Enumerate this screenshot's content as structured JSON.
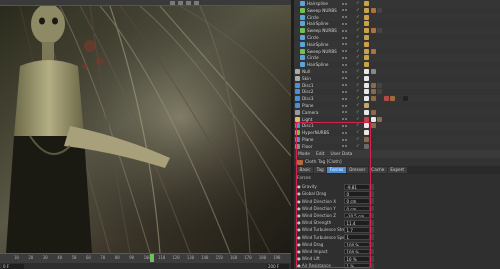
{
  "colors": {
    "accent": "#4a90d9",
    "highlight": "#d6204e",
    "check": "#7ec36f",
    "timeline_cursor": "#6fbf5a"
  },
  "timeline": {
    "ticks": [
      "10",
      "20",
      "30",
      "40",
      "50",
      "60",
      "70",
      "80",
      "90",
      "100",
      "110",
      "120",
      "130",
      "140",
      "150",
      "160",
      "170",
      "180",
      "190"
    ],
    "start_field": "0 F",
    "end_field": "200 F"
  },
  "object_manager": {
    "rows": [
      {
        "name": "Hairspline",
        "icon": "spline-icon"
      },
      {
        "name": "Sweep NURBS",
        "icon": "sweep-icon"
      },
      {
        "name": "Circle",
        "icon": "circle-icon"
      },
      {
        "name": "HairSpline",
        "icon": "spline-icon"
      },
      {
        "name": "Sweep NURBS",
        "icon": "sweep-icon"
      },
      {
        "name": "Circle",
        "icon": "circle-icon"
      },
      {
        "name": "HairSpline",
        "icon": "spline-icon"
      },
      {
        "name": "Sweep NURBS",
        "icon": "sweep-icon"
      },
      {
        "name": "Circle",
        "icon": "circle-icon"
      },
      {
        "name": "HairSpline",
        "icon": "spline-icon"
      },
      {
        "name": "Null",
        "icon": "null-icon"
      },
      {
        "name": "Skin",
        "icon": "null-icon"
      },
      {
        "name": "Disc1",
        "icon": "disc-icon"
      },
      {
        "name": "Disc2",
        "icon": "disc-icon"
      },
      {
        "name": "Disc3",
        "icon": "disc-icon"
      },
      {
        "name": "Plane",
        "icon": "plane-icon"
      },
      {
        "name": "Camera",
        "icon": "camera-icon"
      },
      {
        "name": "Light",
        "icon": "light-icon"
      },
      {
        "name": "Disc1",
        "icon": "disc-icon"
      },
      {
        "name": "HyperNURBS",
        "icon": "hypernurbs-icon"
      },
      {
        "name": "Plane",
        "icon": "plane-icon"
      },
      {
        "name": "Floor",
        "icon": "floor-icon"
      }
    ]
  },
  "attribute_manager": {
    "menu": [
      "Mode",
      "Edit",
      "User Data"
    ],
    "title": "Cloth Tag [Cloth]",
    "tabs": [
      "Basic",
      "Tag",
      "Forces",
      "Dresser",
      "Cache",
      "Expert"
    ],
    "active_tab": "Forces",
    "section": "Forces",
    "params": [
      {
        "label": "Gravity",
        "value": "-9.81"
      },
      {
        "label": "Global Drag",
        "value": "0"
      },
      {
        "label": "Wind Direction X",
        "value": "0 cm"
      },
      {
        "label": "Wind Direction Y",
        "value": "0 cm"
      },
      {
        "label": "Wind Direction Z",
        "value": "-10.5 cm"
      },
      {
        "label": "Wind Strength",
        "value": "11.4"
      },
      {
        "label": "Wind Turbulence Strength",
        "value": "1.7"
      },
      {
        "label": "Wind Turbulence Speed",
        "value": "1"
      },
      {
        "label": "Wind Drag",
        "value": "100 %"
      },
      {
        "label": "Wind Impact",
        "value": "100 %"
      },
      {
        "label": "Wind Lift",
        "value": "10 %"
      },
      {
        "label": "Air Resistance",
        "value": "1 %"
      }
    ]
  }
}
